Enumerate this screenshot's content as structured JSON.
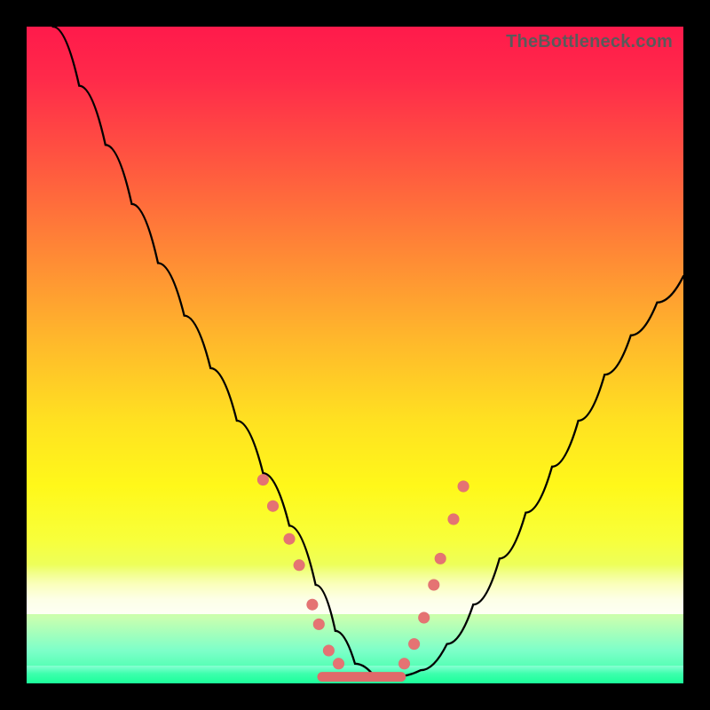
{
  "watermark": "TheBottleneck.com",
  "chart_data": {
    "type": "line",
    "title": "",
    "xlabel": "",
    "ylabel": "",
    "xlim": [
      0,
      100
    ],
    "ylim": [
      0,
      100
    ],
    "grid": false,
    "legend": false,
    "series": [
      {
        "name": "bottleneck-curve",
        "x": [
          0,
          4,
          8,
          12,
          16,
          20,
          24,
          28,
          32,
          36,
          40,
          44,
          47,
          50,
          53,
          56,
          60,
          64,
          68,
          72,
          76,
          80,
          84,
          88,
          92,
          96,
          100
        ],
        "y": [
          108,
          100,
          91,
          82,
          73,
          64,
          56,
          48,
          40,
          32,
          24,
          15,
          8,
          3,
          1,
          1,
          2,
          6,
          12,
          19,
          26,
          33,
          40,
          47,
          53,
          58,
          62
        ]
      }
    ],
    "trough_segment": {
      "x_start": 45,
      "x_end": 57,
      "y": 1
    },
    "dots_left": [
      {
        "x": 36.0,
        "y": 31
      },
      {
        "x": 37.5,
        "y": 27
      },
      {
        "x": 40.0,
        "y": 22
      },
      {
        "x": 41.5,
        "y": 18
      },
      {
        "x": 43.5,
        "y": 12
      },
      {
        "x": 44.5,
        "y": 9
      },
      {
        "x": 46.0,
        "y": 5
      },
      {
        "x": 47.5,
        "y": 3
      }
    ],
    "dots_right": [
      {
        "x": 57.5,
        "y": 3
      },
      {
        "x": 59.0,
        "y": 6
      },
      {
        "x": 60.5,
        "y": 10
      },
      {
        "x": 62.0,
        "y": 15
      },
      {
        "x": 63.0,
        "y": 19
      },
      {
        "x": 65.0,
        "y": 25
      },
      {
        "x": 66.5,
        "y": 30
      }
    ],
    "background_gradient_stops": [
      {
        "pos": 0,
        "color": "#ff1a4b"
      },
      {
        "pos": 50,
        "color": "#ffe121"
      },
      {
        "pos": 100,
        "color": "#2effa0"
      }
    ]
  }
}
